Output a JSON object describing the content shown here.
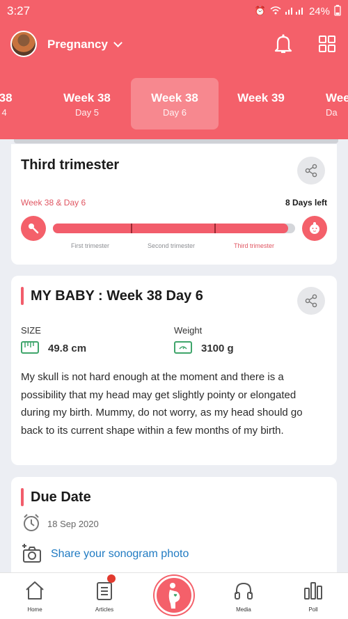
{
  "status_bar": {
    "time": "3:27",
    "battery": "24%"
  },
  "header": {
    "profile_label": "Pregnancy"
  },
  "week_tabs": [
    {
      "week": "k 38",
      "day": "y 4"
    },
    {
      "week": "Week 38",
      "day": "Day 5"
    },
    {
      "week": "Week 38",
      "day": "Day 6"
    },
    {
      "week": "Week 39",
      "day": ""
    },
    {
      "week": "Wee",
      "day": "Da"
    }
  ],
  "trimester_card": {
    "title": "Third trimester",
    "current": "Week 38 & Day 6",
    "days_left": "8 Days left",
    "progress_fraction": 0.97,
    "labels": [
      "First trimester",
      "Second trimester",
      "Third trimester"
    ]
  },
  "baby_card": {
    "title": "MY BABY : Week 38 Day 6",
    "size_label": "SIZE",
    "size_value": "49.8 cm",
    "weight_label": "Weight",
    "weight_value": "3100 g",
    "description": "My skull is not hard enough at the moment and there is a possibility that my head may get slightly pointy or elongated during my birth. Mummy, do not worry, as my head should go back to its current shape within a few months of my birth."
  },
  "due_card": {
    "title": "Due Date",
    "date": "18 Sep 2020",
    "sonogram_link": "Share your sonogram photo"
  },
  "bottom_nav": [
    {
      "label": "Home"
    },
    {
      "label": "Articles"
    },
    {
      "label": "Media"
    },
    {
      "label": "Poll"
    }
  ],
  "colors": {
    "brand": "#f4606a",
    "accent": "#f25d6b",
    "link": "#1f7ac2",
    "icon_green": "#3fa56b"
  }
}
